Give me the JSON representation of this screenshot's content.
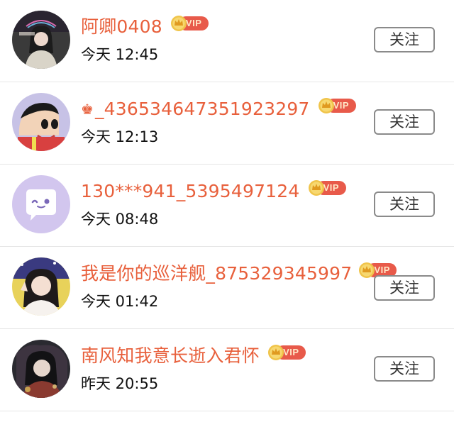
{
  "vip_label": "VIP",
  "follow_label": "关注",
  "colors": {
    "name": "#e8603c",
    "vip_pill": "#e85a4a",
    "medal": "#f0c44a",
    "button_border": "#8a8a8a"
  },
  "users": [
    {
      "name": "阿卿0408",
      "prefix_icon": "",
      "time": "今天 12:45",
      "avatar": "girl-photo-avatar"
    },
    {
      "name": "_436534647351923297",
      "prefix_icon": "crown-icon",
      "time": "今天 12:13",
      "avatar": "cartoon-boy-avatar"
    },
    {
      "name": "130***941_5395497124",
      "prefix_icon": "",
      "time": "今天 08:48",
      "avatar": "chat-bubble-avatar"
    },
    {
      "name": "我是你的巡洋舰_875329345997",
      "prefix_icon": "",
      "time": "今天 01:42",
      "avatar": "girl-selfie-avatar"
    },
    {
      "name": "南风知我意长逝入君怀",
      "prefix_icon": "",
      "time": "昨天 20:55",
      "avatar": "dark-portrait-avatar"
    }
  ]
}
